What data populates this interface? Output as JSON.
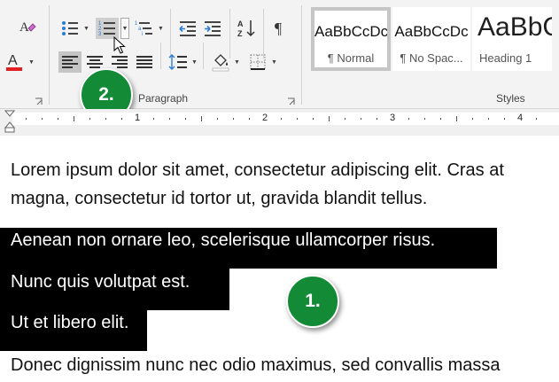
{
  "ribbon": {
    "paragraph_group_label": "Paragraph",
    "styles_group_label": "Styles",
    "styles": [
      {
        "preview": "AaBbCcDc",
        "name": "¶ Normal",
        "selected": true
      },
      {
        "preview": "AaBbCcDc",
        "name": "¶ No Spac...",
        "selected": false
      },
      {
        "preview": "AaBbC",
        "name": "Heading 1",
        "selected": false
      }
    ]
  },
  "ruler": {
    "numbers": [
      "1",
      "2",
      "3",
      "4"
    ]
  },
  "document": {
    "paragraph1_line1": "Lorem ipsum dolor sit amet, consectetur adipiscing elit. Cras at",
    "paragraph1_line2": "magna, consectetur id tortor ut, gravida blandit tellus.",
    "selected_lines": [
      "Aenean non ornare leo, scelerisque ullamcorper risus.",
      "Nunc quis volutpat est.",
      "Ut et libero elit."
    ],
    "paragraph_last": "Donec dignissim nunc nec odio maximus, sed convallis massa"
  },
  "callouts": {
    "step1": "1.",
    "step2": "2."
  },
  "colors": {
    "badge_green": "#138a36",
    "font_color_red": "#e02020",
    "selection": "#000000"
  }
}
